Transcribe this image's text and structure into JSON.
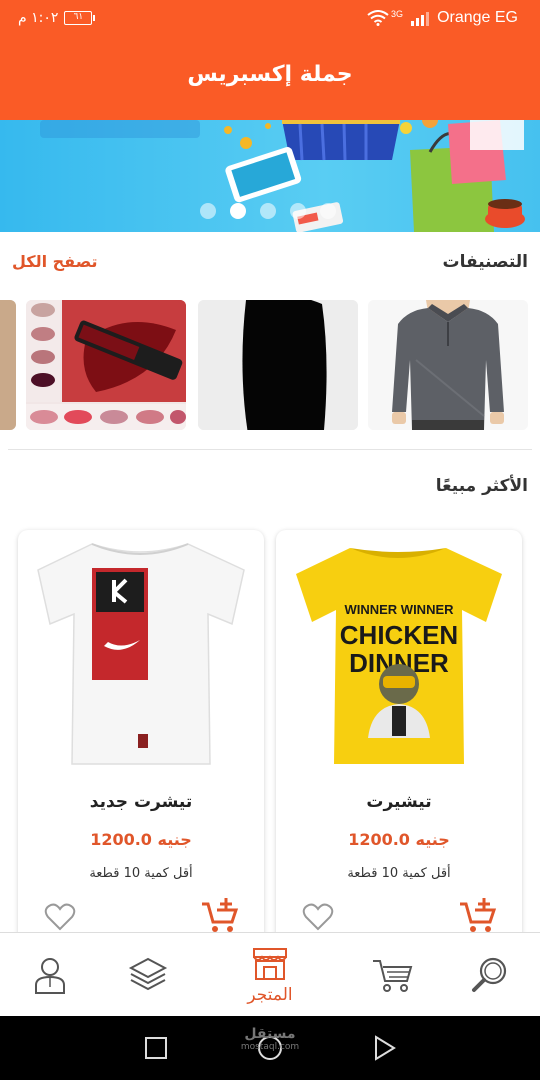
{
  "status_bar": {
    "time": "١:٠٢ م",
    "battery": "٦١",
    "network_type": "3G",
    "carrier": "Orange EG"
  },
  "header": {
    "title": "جملة إكسبريس"
  },
  "banner": {
    "slide_count": 5,
    "active_index": 1
  },
  "categories": {
    "title": "التصنيفات",
    "browse_all": "تصفح الكل"
  },
  "best_sellers": {
    "title": "الأكثر مبيعًا",
    "products": [
      {
        "name": "تيشيرت",
        "price": "1200.0 جنيه",
        "min_qty": "أقل كمية 10 قطعة",
        "shirt_text_1": "WINNER WINNER",
        "shirt_text_2": "CHICKEN",
        "shirt_text_3": "DINNER"
      },
      {
        "name": "تيشرت جديد",
        "price": "1200.0 جنيه",
        "min_qty": "أقل كمية 10 قطعة"
      }
    ]
  },
  "bottom_nav": {
    "active_label": "المتجر",
    "items": [
      "search",
      "cart",
      "store",
      "categories",
      "profile"
    ]
  },
  "watermark": {
    "line1": "مستقل",
    "line2": "mostaql.com"
  },
  "colors": {
    "accent": "#fa5b26",
    "price": "#e0562a"
  }
}
